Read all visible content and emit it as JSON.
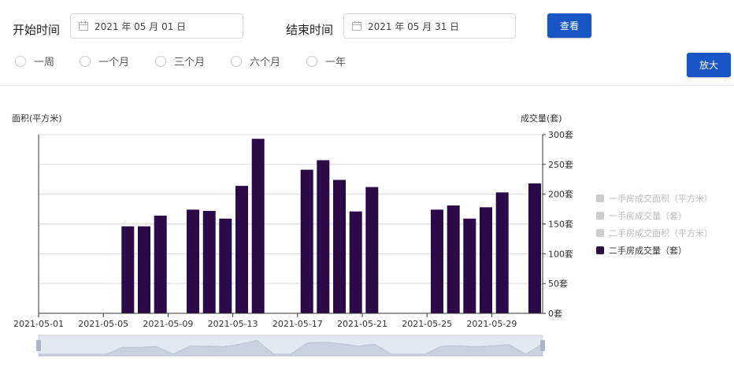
{
  "filters": {
    "start_label": "开始时间",
    "start_value": "2021 年 05 月 01 日",
    "end_label": "结束时间",
    "end_value": "2021 年 05 月 31 日",
    "view_button": "查看",
    "zoom_button": "放大",
    "ranges": [
      "一周",
      "一个月",
      "三个月",
      "六个月",
      "一年"
    ]
  },
  "colors": {
    "bar": "#2c0a4a",
    "accent": "#1756c4",
    "legend_inactive": "#cccccc"
  },
  "chart_data": {
    "type": "bar",
    "y_left_name": "面积(平方米)",
    "y_right_name": "成交量(套)",
    "y_right_ticks": [
      "0套",
      "50套",
      "100套",
      "150套",
      "200套",
      "250套",
      "300套"
    ],
    "ylim": [
      0,
      300
    ],
    "x_tick_labels": [
      "2021-05-01",
      "2021-05-05",
      "2021-05-09",
      "2021-05-13",
      "2021-05-17",
      "2021-05-21",
      "2021-05-25",
      "2021-05-29"
    ],
    "x": [
      "2021-05-01",
      "2021-05-02",
      "2021-05-03",
      "2021-05-04",
      "2021-05-05",
      "2021-05-06",
      "2021-05-07",
      "2021-05-08",
      "2021-05-09",
      "2021-05-10",
      "2021-05-11",
      "2021-05-12",
      "2021-05-13",
      "2021-05-14",
      "2021-05-15",
      "2021-05-16",
      "2021-05-17",
      "2021-05-18",
      "2021-05-19",
      "2021-05-20",
      "2021-05-21",
      "2021-05-22",
      "2021-05-23",
      "2021-05-24",
      "2021-05-25",
      "2021-05-26",
      "2021-05-27",
      "2021-05-28",
      "2021-05-29",
      "2021-05-30",
      "2021-05-31"
    ],
    "series": [
      {
        "name": "一手房成交面积（平方米）",
        "active": false,
        "values": []
      },
      {
        "name": "一手房成交量（套）",
        "active": false,
        "values": []
      },
      {
        "name": "二手房成交面积（平方米）",
        "active": false,
        "values": []
      },
      {
        "name": "二手房成交量（套）",
        "active": true,
        "values": [
          0,
          0,
          0,
          0,
          0,
          146,
          146,
          164,
          0,
          174,
          172,
          159,
          214,
          293,
          0,
          0,
          241,
          257,
          224,
          171,
          212,
          0,
          0,
          0,
          174,
          181,
          159,
          178,
          203,
          0,
          218
        ]
      }
    ],
    "legend_position": "right",
    "grid": true
  }
}
